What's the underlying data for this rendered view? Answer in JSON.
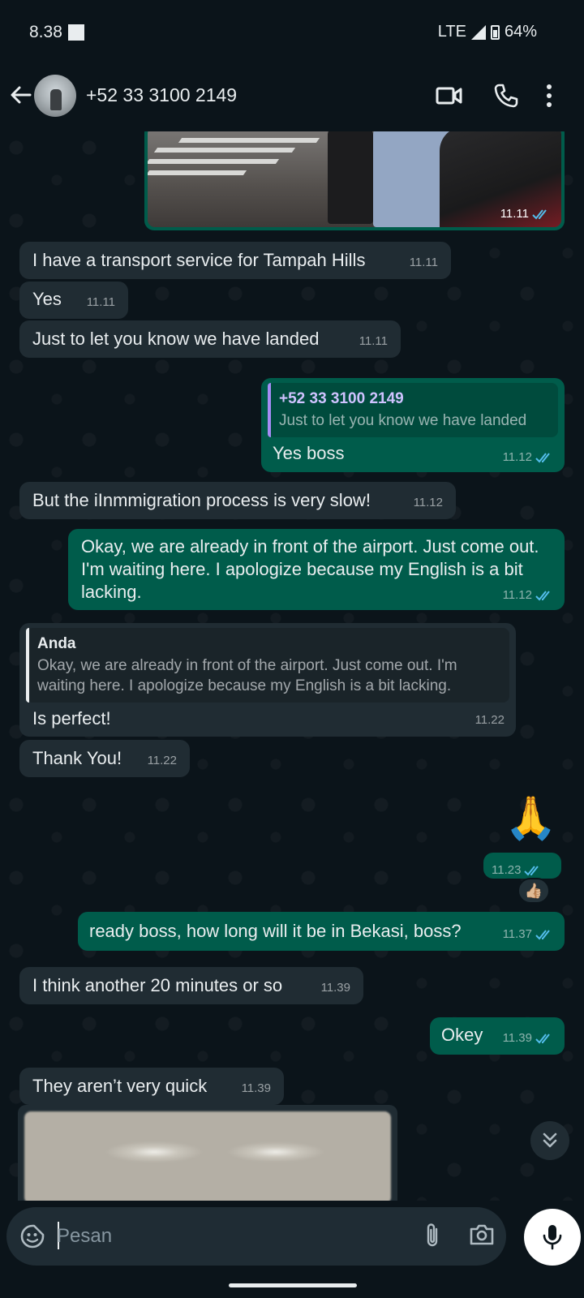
{
  "status_bar": {
    "time": "8.38",
    "network": "LTE",
    "battery": "64%"
  },
  "header": {
    "contact_name": "+52 33 3100 2149"
  },
  "messages": [
    {
      "kind": "media",
      "direction": "out",
      "time": "11.11"
    },
    {
      "direction": "in",
      "text": "I have a transport service for Tampah Hills",
      "time": "11.11"
    },
    {
      "direction": "in",
      "text": "Yes",
      "time": "11.11"
    },
    {
      "direction": "in",
      "text": "Just to let you know we have landed",
      "time": "11.11"
    },
    {
      "direction": "out",
      "quote_author": "+52 33 3100 2149",
      "quote_text": "Just to let you know we have landed",
      "text": "Yes boss",
      "time": "11.12"
    },
    {
      "direction": "in",
      "text": "But the iInmmigration process is very slow!",
      "time": "11.12"
    },
    {
      "direction": "out",
      "text": "Okay, we are already in front of the airport. Just come out. I'm waiting here. I apologize because my English is a bit lacking.",
      "time": "11.12"
    },
    {
      "direction": "in",
      "quote_author": "Anda",
      "quote_text": "Okay, we are already in front of the airport. Just come out. I'm waiting here. I apologize because my English is a bit lacking.",
      "text": "Is perfect!",
      "time": "11.22"
    },
    {
      "direction": "in",
      "text": "Thank You!",
      "time": "11.22"
    },
    {
      "direction": "out",
      "kind": "emoji",
      "emoji": "🙏",
      "time": "11.23",
      "reaction": "👍🏼"
    },
    {
      "direction": "out",
      "text": "ready boss, how long will it be in Bekasi, boss?",
      "time": "11.37"
    },
    {
      "direction": "in",
      "text": "I think another 20 minutes or so",
      "time": "11.39"
    },
    {
      "direction": "out",
      "text": "Okey",
      "time": "11.39"
    },
    {
      "direction": "in",
      "text": "They aren’t very quick",
      "time": "11.39"
    },
    {
      "kind": "media",
      "direction": "in"
    }
  ],
  "composer": {
    "placeholder": "Pesan"
  },
  "colors": {
    "background": "#0b141a",
    "incoming": "#202c33",
    "outgoing": "#005c4b",
    "read_ticks": "#53bdeb"
  }
}
